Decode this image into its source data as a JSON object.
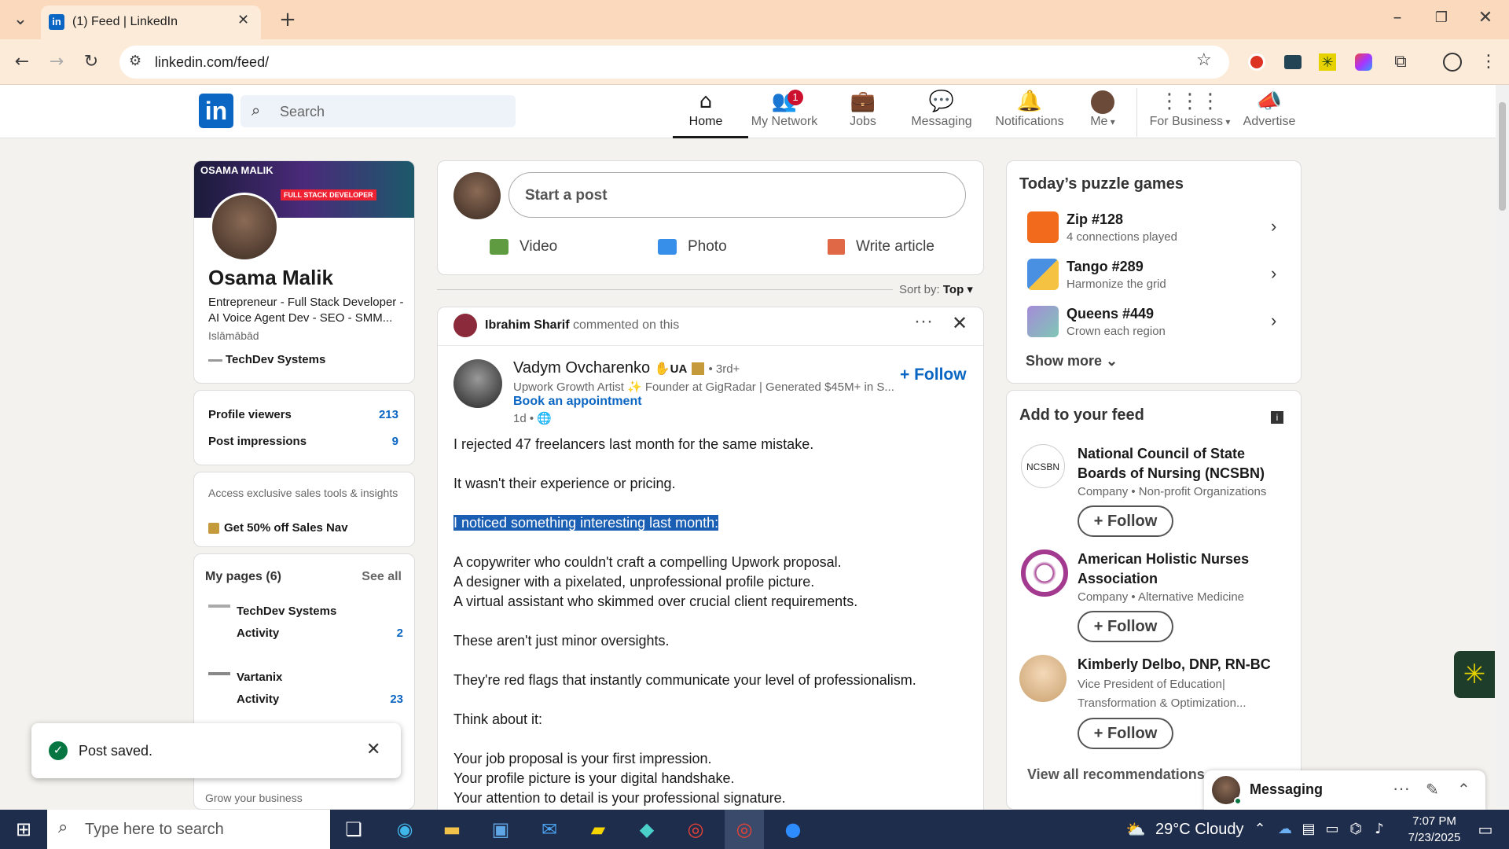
{
  "browser": {
    "tab_title": "(1) Feed | LinkedIn",
    "url": "linkedin.com/feed/"
  },
  "nav": {
    "search_placeholder": "Search",
    "items": [
      {
        "label": "Home",
        "icon": "home-icon"
      },
      {
        "label": "My Network",
        "icon": "network-icon",
        "badge": "1"
      },
      {
        "label": "Jobs",
        "icon": "briefcase-icon"
      },
      {
        "label": "Messaging",
        "icon": "messaging-icon"
      },
      {
        "label": "Notifications",
        "icon": "bell-icon"
      },
      {
        "label": "Me",
        "icon": "avatar"
      },
      {
        "label": "For Business",
        "icon": "grid-icon"
      },
      {
        "label": "Advertise",
        "icon": "megaphone-icon"
      }
    ]
  },
  "profile": {
    "banner_text_1": "OSAMA MALIK",
    "banner_text_2": "FULL STACK DEVELOPER",
    "name": "Osama Malik",
    "headline": "Entrepreneur - Full Stack Developer - AI Voice Agent Dev - SEO - SMM...",
    "location": "Islāmābād",
    "company": "TechDev Systems",
    "stats": [
      {
        "label": "Profile viewers",
        "value": "213"
      },
      {
        "label": "Post impressions",
        "value": "9"
      }
    ],
    "premium_text": "Access exclusive sales tools & insights",
    "premium_link": "Get 50% off Sales Nav",
    "pages_title": "My pages (6)",
    "see_all": "See all",
    "pages": [
      {
        "name": "TechDev Systems",
        "activity_label": "Activity",
        "activity": "2"
      },
      {
        "name": "Vartanix",
        "activity_label": "Activity",
        "activity": "23"
      }
    ],
    "grow": "Grow your business"
  },
  "composer": {
    "placeholder": "Start a post",
    "actions": [
      "Video",
      "Photo",
      "Write article"
    ]
  },
  "sort": {
    "label": "Sort by:",
    "value": "Top"
  },
  "post": {
    "commenter": "Ibrahim Sharif",
    "commented_text": "commented on this",
    "author": "Vadym Ovcharenko",
    "author_suffix": "UA",
    "degree": "• 3rd+",
    "subtitle": "Upwork Growth Artist ✨ Founder at GigRadar | Generated $45M+ in S...",
    "book": "Book an appointment",
    "time": "1d •",
    "follow": "+ Follow",
    "lines": [
      "I rejected 47 freelancers last month for the same mistake.",
      "",
      "It wasn't their experience or pricing.",
      "",
      "I noticed something interesting last month:",
      "",
      "A copywriter who couldn't craft a compelling Upwork proposal.",
      "A designer with a pixelated, unprofessional profile picture.",
      "A virtual assistant who skimmed over crucial client requirements.",
      "",
      "These aren't just minor oversights.",
      "",
      "They're red flags that instantly communicate your level of professionalism.",
      "",
      "Think about it:",
      "",
      "Your job proposal is your first impression.",
      "Your profile picture is your digital handshake.",
      "Your attention to detail is your professional signature."
    ]
  },
  "puzzles": {
    "title": "Today’s puzzle games",
    "items": [
      {
        "name": "Zip #128",
        "sub": "4 connections played"
      },
      {
        "name": "Tango #289",
        "sub": "Harmonize the grid"
      },
      {
        "name": "Queens #449",
        "sub": "Crown each region"
      }
    ],
    "show_more": "Show more"
  },
  "feed_suggestions": {
    "title": "Add to your feed",
    "items": [
      {
        "name": "National Council of State Boards of Nursing (NCSBN)",
        "sub": "Company • Non-profit Organizations",
        "logo": "NCSBN"
      },
      {
        "name": "American Holistic Nurses Association",
        "sub": "Company • Alternative Medicine"
      },
      {
        "name": "Kimberly Delbo, DNP, RN-BC",
        "sub": "Vice President of Education| Transformation & Optimization..."
      }
    ],
    "follow": "+ Follow",
    "view_all": "View all recommendations →"
  },
  "messaging": {
    "label": "Messaging"
  },
  "toast": {
    "text": "Post saved."
  },
  "taskbar": {
    "search_placeholder": "Type here to search",
    "weather": "29°C  Cloudy",
    "time": "7:07 PM",
    "date": "7/23/2025"
  },
  "colors": {
    "linkedin_blue": "#0a66c2",
    "highlight": "#1a5fb4",
    "taskbar": "#1f2d4d",
    "chrome_tab": "#fbd9bd"
  }
}
